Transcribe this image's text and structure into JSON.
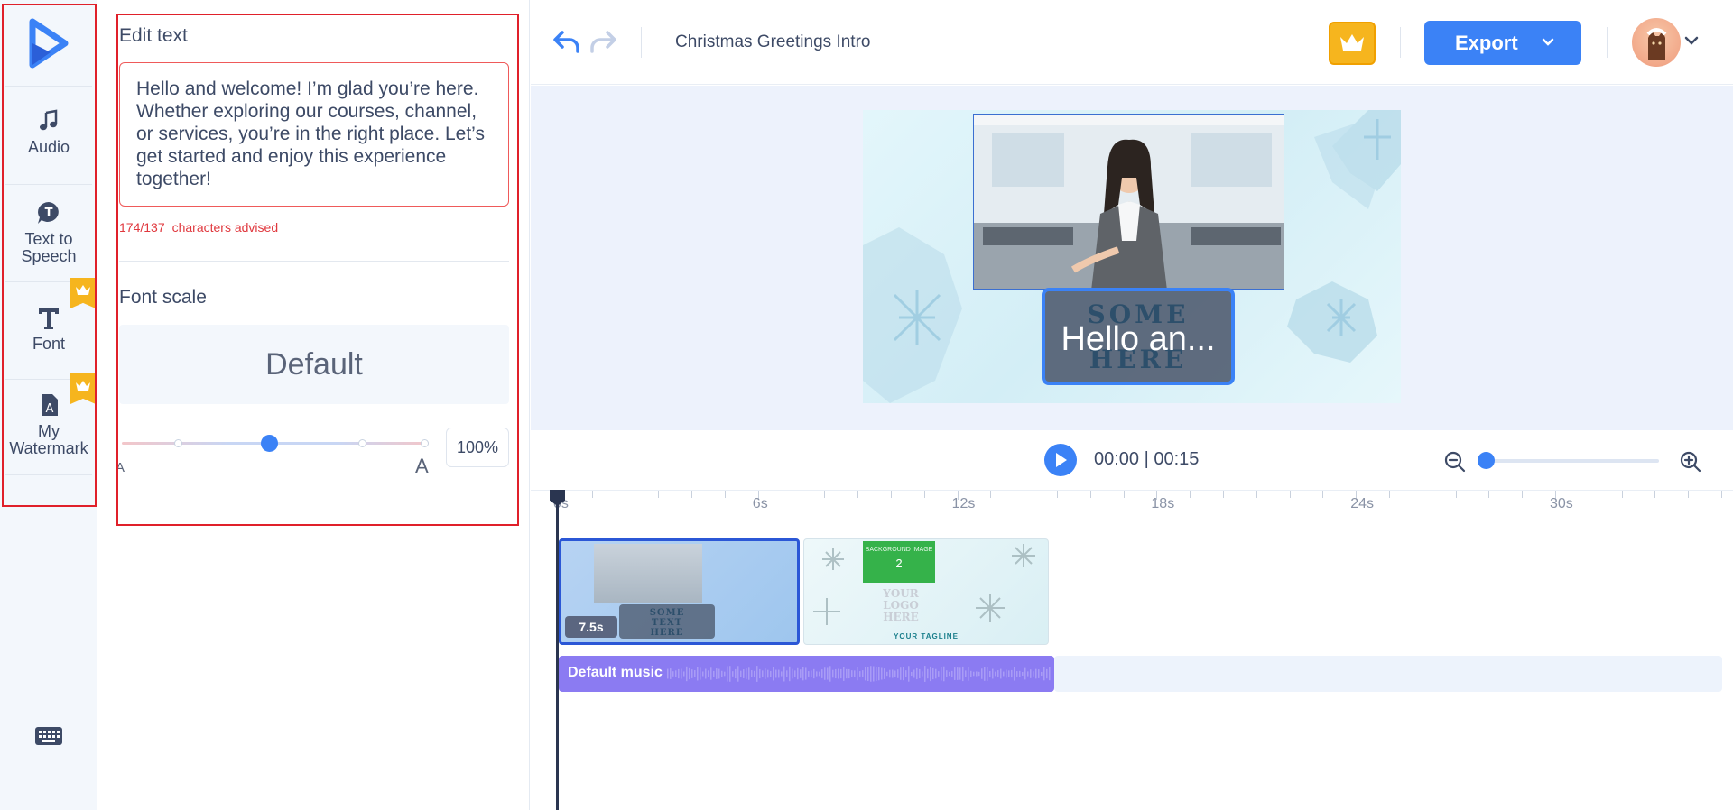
{
  "sidebar": {
    "items": [
      {
        "label": "Audio",
        "icon": "music-note-icon",
        "premium": false
      },
      {
        "label": "Text to Speech",
        "icon": "text-to-speech-icon",
        "premium": false
      },
      {
        "label": "Font",
        "icon": "font-icon",
        "premium": true
      },
      {
        "label": "My Watermark",
        "icon": "watermark-icon",
        "premium": true
      }
    ],
    "keyboard_icon": "keyboard-icon"
  },
  "panel": {
    "edit_title": "Edit text",
    "text_value": "Hello and welcome! I’m glad you’re here. Whether exploring our courses, channel, or services, you’re in the right place. Let’s get started and enjoy this experience together!",
    "char_count": "174/137",
    "char_note": "characters advised",
    "font_scale_title": "Font scale",
    "font_scale_value": "Default",
    "slider_small_label": "A",
    "slider_large_label": "A",
    "slider_level": 0.48,
    "scale_percent": "100%"
  },
  "topbar": {
    "project_title": "Christmas Greetings Intro",
    "export_label": "Export",
    "accent_color": "#3b82f6",
    "premium_color": "#f6b51e"
  },
  "preview": {
    "overlay_back_text": [
      "SOME",
      "HERE"
    ],
    "overlay_front_text": "Hello an..."
  },
  "playback": {
    "time": "00:00 | 00:15",
    "zoom_level": 0.0
  },
  "timeline": {
    "ticks": [
      "0s",
      "6s",
      "12s",
      "18s",
      "24s",
      "30s"
    ],
    "clips": [
      {
        "duration": "7.5s",
        "text": [
          "SOME",
          "TEXT",
          "HERE"
        ]
      },
      {
        "bg_text": "BACKGROUND IMAGE",
        "bg_num": "2",
        "logo_text": [
          "YOUR",
          "LOGO",
          "HERE"
        ],
        "tagline": "YOUR TAGLINE"
      }
    ],
    "music_label": "Default music"
  }
}
